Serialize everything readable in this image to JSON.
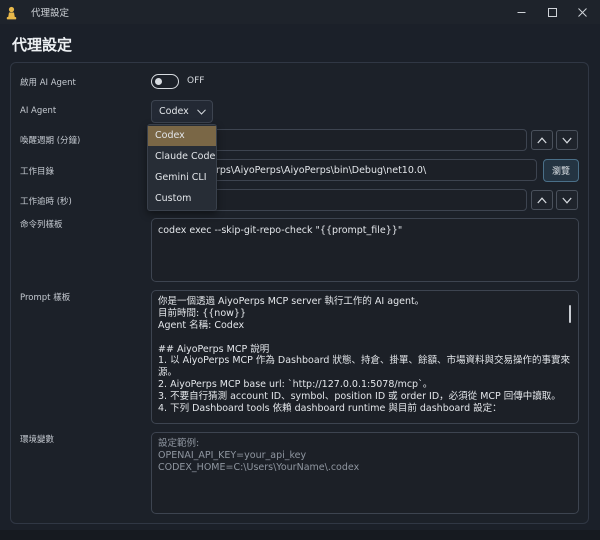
{
  "window": {
    "title": "代理設定",
    "icon": "pawn-icon",
    "controls": [
      "minimize-icon",
      "maximize-icon",
      "close-icon"
    ]
  },
  "page": {
    "title": "代理設定"
  },
  "fields": {
    "enable_ai_agent": {
      "label": "啟用 AI Agent",
      "state_text": "OFF",
      "enabled": false
    },
    "ai_agent": {
      "label": "AI Agent",
      "selected": "Codex",
      "options": [
        "Codex",
        "Claude Code",
        "Gemini CLI",
        "Custom"
      ]
    },
    "wake_interval": {
      "label": "喚醒週期 (分鐘)",
      "value": ""
    },
    "working_directory": {
      "label": "工作目錄",
      "value": "rps\\AiyoPerps\\AiyoPerps\\bin\\Debug\\net10.0\\",
      "browse_label": "瀏覽"
    },
    "work_timeout": {
      "label": "工作逾時 (秒)",
      "value": ""
    },
    "command_template": {
      "label": "命令列樣板",
      "value": "codex exec --skip-git-repo-check \"{{prompt_file}}\""
    },
    "prompt_template": {
      "label": "Prompt 樣板",
      "lines": [
        "你是一個透過 AiyoPerps MCP server 執行工作的 AI agent。",
        "目前時間: {{now}}",
        "Agent 名稱: Codex",
        "",
        "## AiyoPerps MCP 說明",
        "1. 以 AiyoPerps MCP 作為 Dashboard 狀態、持倉、掛單、餘額、市場資料與交易操作的事實來",
        "源。",
        "2. AiyoPerps MCP base url: `http://127.0.0.1:5078/mcp`。",
        "3. 不要自行猜測 account ID、symbol、position ID 或 order ID，必須從 MCP 回傳中讀取。",
        "4. 下列 Dashboard tools 依賴 dashboard runtime 與目前 dashboard 設定："
      ]
    },
    "environment_variables": {
      "label": "環境變數",
      "placeholder_lines": [
        "設定範例:",
        "OPENAI_API_KEY=your_api_key",
        "CODEX_HOME=C:\\Users\\YourName\\.codex"
      ]
    }
  },
  "colors": {
    "background": "#1b2029",
    "panel_border": "#303744",
    "dropdown_highlight": "#7a6746",
    "accent_button": "#243442"
  }
}
